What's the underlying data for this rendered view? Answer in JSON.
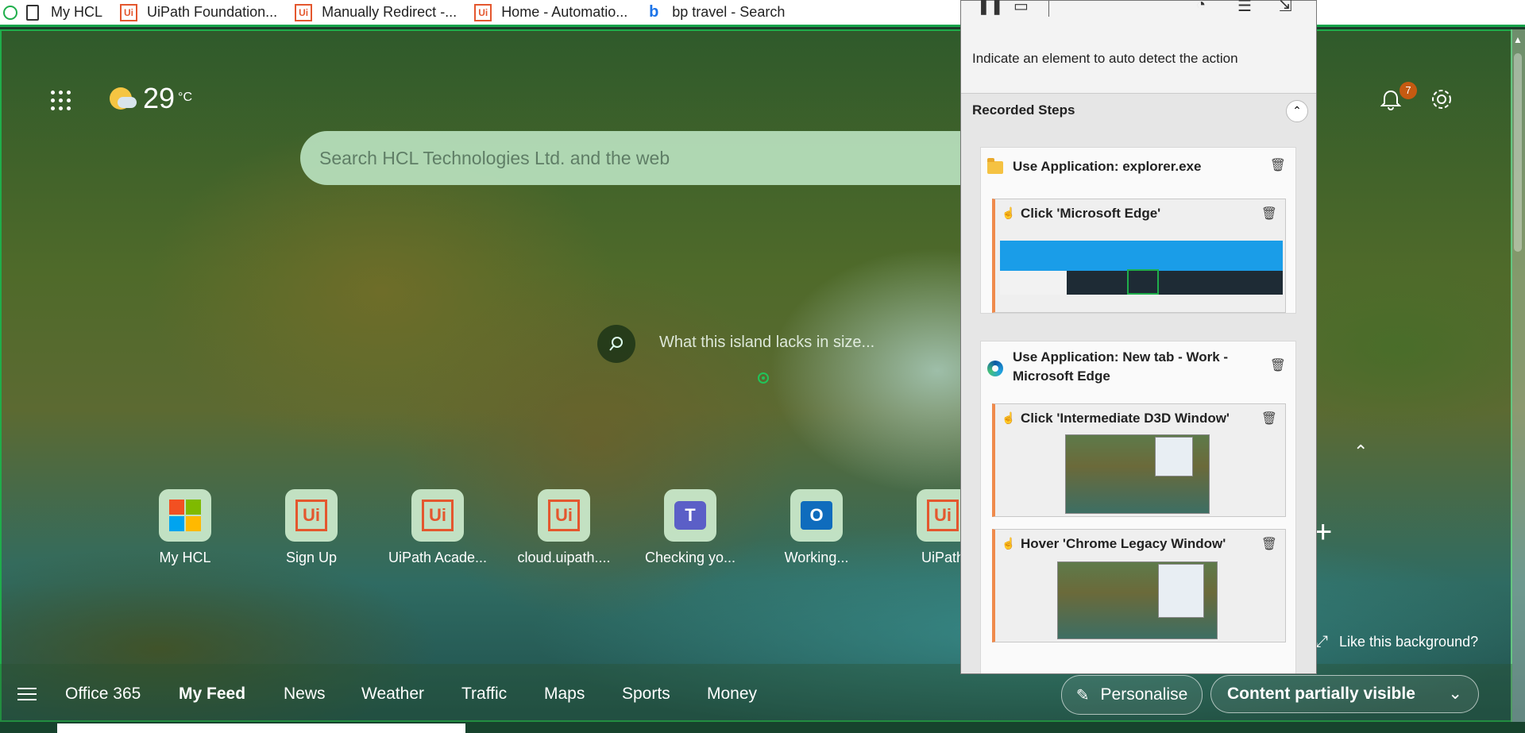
{
  "favorites": [
    {
      "label": "My HCL",
      "icon": "document-icon"
    },
    {
      "label": "UiPath Foundation...",
      "icon": "uipath-icon"
    },
    {
      "label": "Manually Redirect -...",
      "icon": "uipath-icon"
    },
    {
      "label": "Home - Automatio...",
      "icon": "uipath-icon"
    },
    {
      "label": "bp travel - Search",
      "icon": "bing-icon"
    }
  ],
  "weather": {
    "temp": "29",
    "unit": "°C"
  },
  "search": {
    "placeholder": "Search HCL Technologies Ltd. and the web"
  },
  "notifications": {
    "count": "7"
  },
  "island": {
    "caption": "What this island lacks in size..."
  },
  "quick_links": [
    {
      "label": "My HCL",
      "icon": "microsoft-icon"
    },
    {
      "label": "Sign Up",
      "icon": "uipath-icon"
    },
    {
      "label": "UiPath Acade...",
      "icon": "uipath-icon"
    },
    {
      "label": "cloud.uipath....",
      "icon": "uipath-icon"
    },
    {
      "label": "Checking yo...",
      "icon": "teams-icon"
    },
    {
      "label": "Working...",
      "icon": "outlook-icon"
    },
    {
      "label": "UiPath",
      "icon": "uipath-icon"
    }
  ],
  "like_background": "Like this background?",
  "bottom_nav": {
    "items": [
      "Office 365",
      "My Feed",
      "News",
      "Weather",
      "Traffic",
      "Maps",
      "Sports",
      "Money"
    ],
    "active": "My Feed",
    "personalise": "Personalise",
    "content_visibility": "Content partially visible"
  },
  "recorder": {
    "instruction": "Indicate an element to auto detect the action",
    "recorded_steps_label": "Recorded Steps",
    "steps": [
      {
        "title": "Use Application: explorer.exe",
        "icon": "folder-icon",
        "actions": [
          {
            "title": "Click 'Microsoft Edge'"
          }
        ]
      },
      {
        "title": "Use Application: New tab - Work - Microsoft Edge",
        "icon": "edge-icon",
        "actions": [
          {
            "title": "Click 'Intermediate D3D Window'"
          },
          {
            "title": "Hover 'Chrome Legacy Window'"
          }
        ]
      }
    ]
  }
}
